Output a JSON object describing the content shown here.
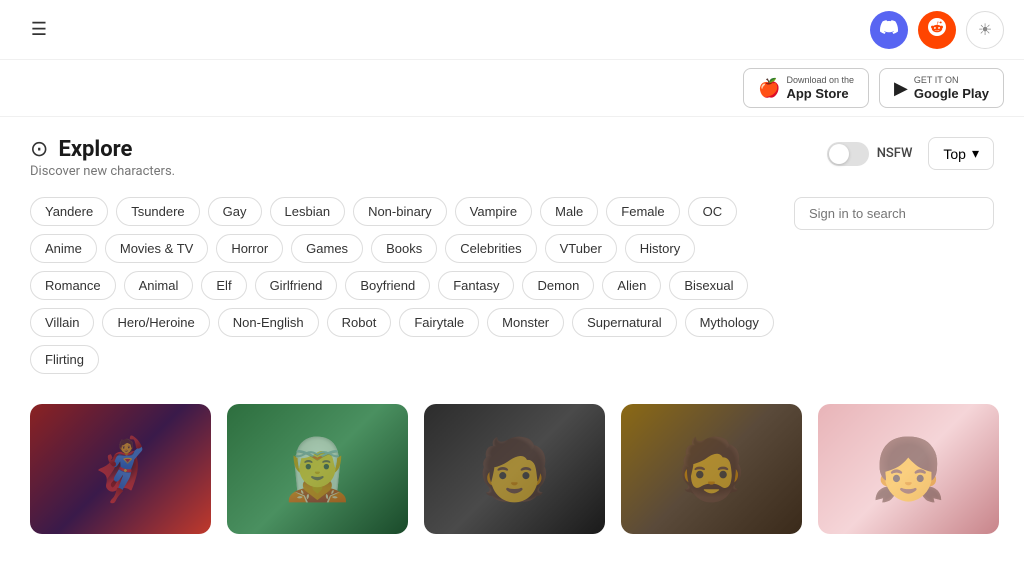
{
  "navbar": {
    "hamburger_label": "☰",
    "discord_icon": "💬",
    "reddit_icon": "🔴",
    "theme_icon": "☀"
  },
  "store_row": {
    "app_store": {
      "small": "Download on the",
      "name": "App Store",
      "icon": ""
    },
    "google_play": {
      "small": "GET IT ON",
      "name": "Google Play",
      "icon": "▶"
    }
  },
  "explore": {
    "icon": "⊙",
    "title": "Explore",
    "subtitle": "Discover new characters."
  },
  "controls": {
    "nsfw_label": "NSFW",
    "top_label": "Top",
    "chevron": "▾"
  },
  "tags": [
    "Yandere",
    "Tsundere",
    "Gay",
    "Lesbian",
    "Non-binary",
    "Vampire",
    "Male",
    "Female",
    "OC",
    "Anime",
    "Movies & TV",
    "Horror",
    "Games",
    "Books",
    "Celebrities",
    "VTuber",
    "History",
    "Romance",
    "Animal",
    "Elf",
    "Girlfriend",
    "Boyfriend",
    "Fantasy",
    "Demon",
    "Alien",
    "Bisexual",
    "Villain",
    "Hero/Heroine",
    "Non-English",
    "Robot",
    "Fairytale",
    "Monster",
    "Supernatural",
    "Mythology",
    "Flirting"
  ],
  "search": {
    "placeholder": "Sign in to search"
  },
  "cards": [
    {
      "id": 1,
      "color_class": "card-1",
      "emoji": "🦸"
    },
    {
      "id": 2,
      "color_class": "card-2",
      "emoji": "🧝"
    },
    {
      "id": 3,
      "color_class": "card-3",
      "emoji": "🧑"
    },
    {
      "id": 4,
      "color_class": "card-4",
      "emoji": "🧔"
    },
    {
      "id": 5,
      "color_class": "card-5",
      "emoji": "👧"
    }
  ]
}
